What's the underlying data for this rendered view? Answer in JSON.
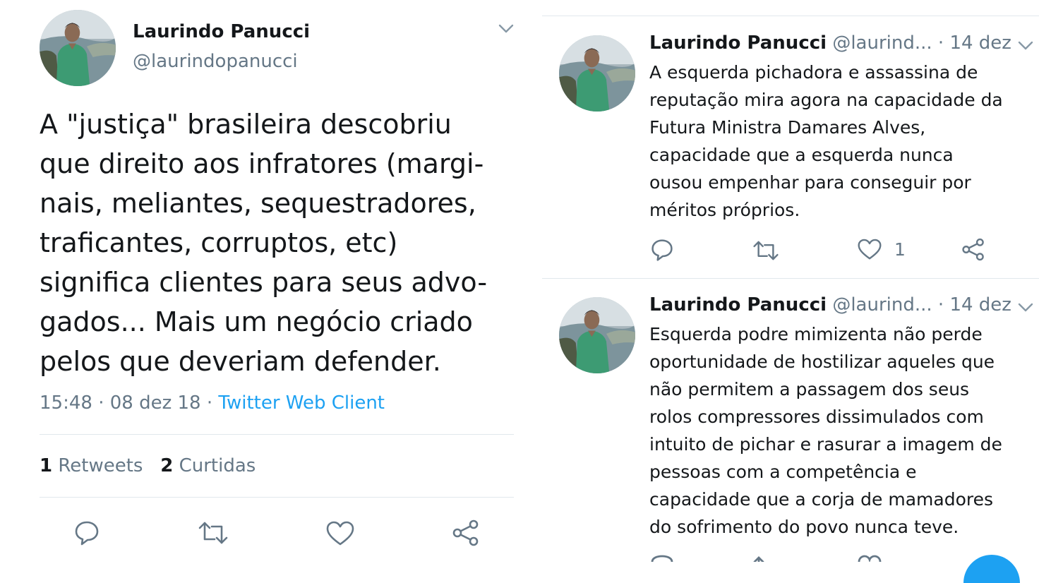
{
  "main_tweet": {
    "author_name": "Laurindo Panucci",
    "author_handle": "@laurindopanucci",
    "text": "A \"justiça\" brasileira descobriu\nque direito aos infratores (margi-\nnais, meliantes, sequestradores,\ntraficantes, corruptos, etc)\nsignifica clientes para seus advo-\ngados... Mais um negócio criado\npelos que deveriam defender.",
    "time": "15:48 · 08 dez 18 · ",
    "source": "Twitter Web Client",
    "retweets_count": "1",
    "retweets_label": "Retweets",
    "likes_count": "2",
    "likes_label": "Curtidas"
  },
  "replies": [
    {
      "author_name": "Laurindo Panucci",
      "author_handle": "@laurind...",
      "date": "· 14 dez",
      "text": "A esquerda pichadora e assassina de\nreputação mira agora na capacidade da\nFutura Ministra Damares Alves,\ncapacidade que a esquerda nunca\nousou empenhar para conseguir por\nméritos próprios.",
      "like_count": "1"
    },
    {
      "author_name": "Laurindo Panucci",
      "author_handle": "@laurind...",
      "date": "· 14 dez",
      "text": "Esquerda podre mimizenta não perde\noportunidade de hostilizar aqueles que\nnão permitem a passagem dos seus\nrolos compressores dissimulados com\nintuito de pichar e rasurar a imagem de\npessoas com a competência e\ncapacidade que a corja de mamadores\ndo sofrimento do povo nunca teve."
    }
  ],
  "colors": {
    "text": "#14171a",
    "secondary": "#657786",
    "link": "#1da1f2",
    "divider": "#e1e8ed"
  }
}
